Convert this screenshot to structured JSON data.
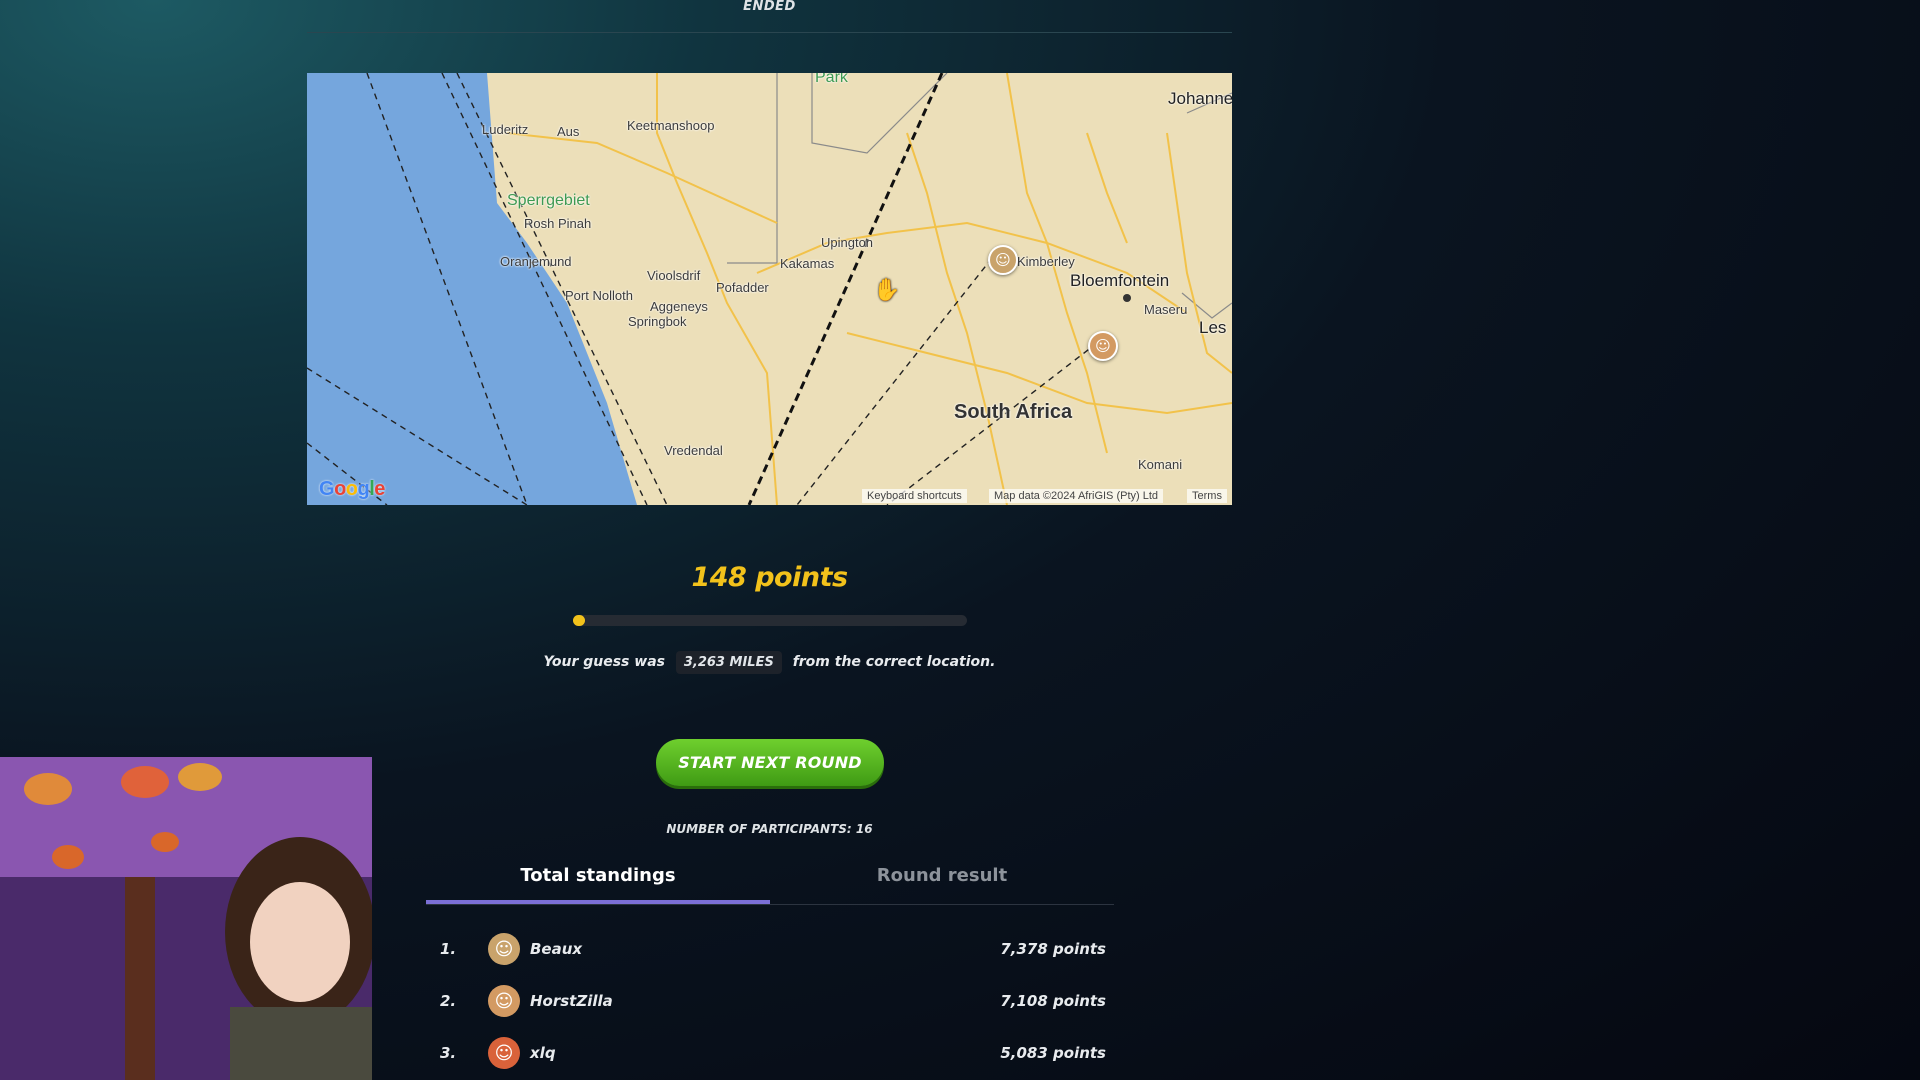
{
  "round_status": "ENDED",
  "map": {
    "labels": {
      "luderitz": "Luderitz",
      "aus": "Aus",
      "keetmanshoop": "Keetmanshoop",
      "park": "Park",
      "johannesburg": "Johanne",
      "sperrgebiet": "Sperrgebiet",
      "rosh_pinah": "Rosh Pinah",
      "oranjemund": "Oranjemund",
      "upington": "Upington",
      "kakamas": "Kakamas",
      "kimberley": "Kimberley",
      "bloemfontein": "Bloemfontein",
      "maseru": "Maseru",
      "lesotho": "Les",
      "vioolsdrif": "Vioolsdrif",
      "pofadder": "Pofadder",
      "port_nolloth": "Port Nolloth",
      "aggeneys": "Aggeneys",
      "springbok": "Springbok",
      "south_africa": "South Africa",
      "vredendal": "Vredendal",
      "komani": "Komani"
    },
    "google_logo": "Google",
    "keyboard_shortcuts": "Keyboard shortcuts",
    "map_data": "Map data ©2024 AfriGIS (Pty) Ltd",
    "terms": "Terms",
    "colors": {
      "water": "#75a6dd",
      "land": "#ecdfb9",
      "roads": "#f2c24a"
    }
  },
  "result": {
    "points_text": "148 points",
    "points": 148,
    "progress_fraction": 0.03,
    "guess_prefix": "Your guess was",
    "distance": "3,263 MILES",
    "guess_suffix": "from the correct location."
  },
  "next_round_button": "START NEXT ROUND",
  "participants_text": "NUMBER OF PARTICIPANTS: 16",
  "tabs": [
    {
      "label": "Total standings",
      "active": true
    },
    {
      "label": "Round result",
      "active": false
    }
  ],
  "standings": [
    {
      "rank": "1.",
      "name": "Beaux",
      "points": "7,378 points",
      "avatar_color": "#c9a36b"
    },
    {
      "rank": "2.",
      "name": "HorstZilla",
      "points": "7,108 points",
      "avatar_color": "#d39a62"
    },
    {
      "rank": "3.",
      "name": "xlq",
      "points": "5,083 points",
      "avatar_color": "#d9623a"
    }
  ]
}
